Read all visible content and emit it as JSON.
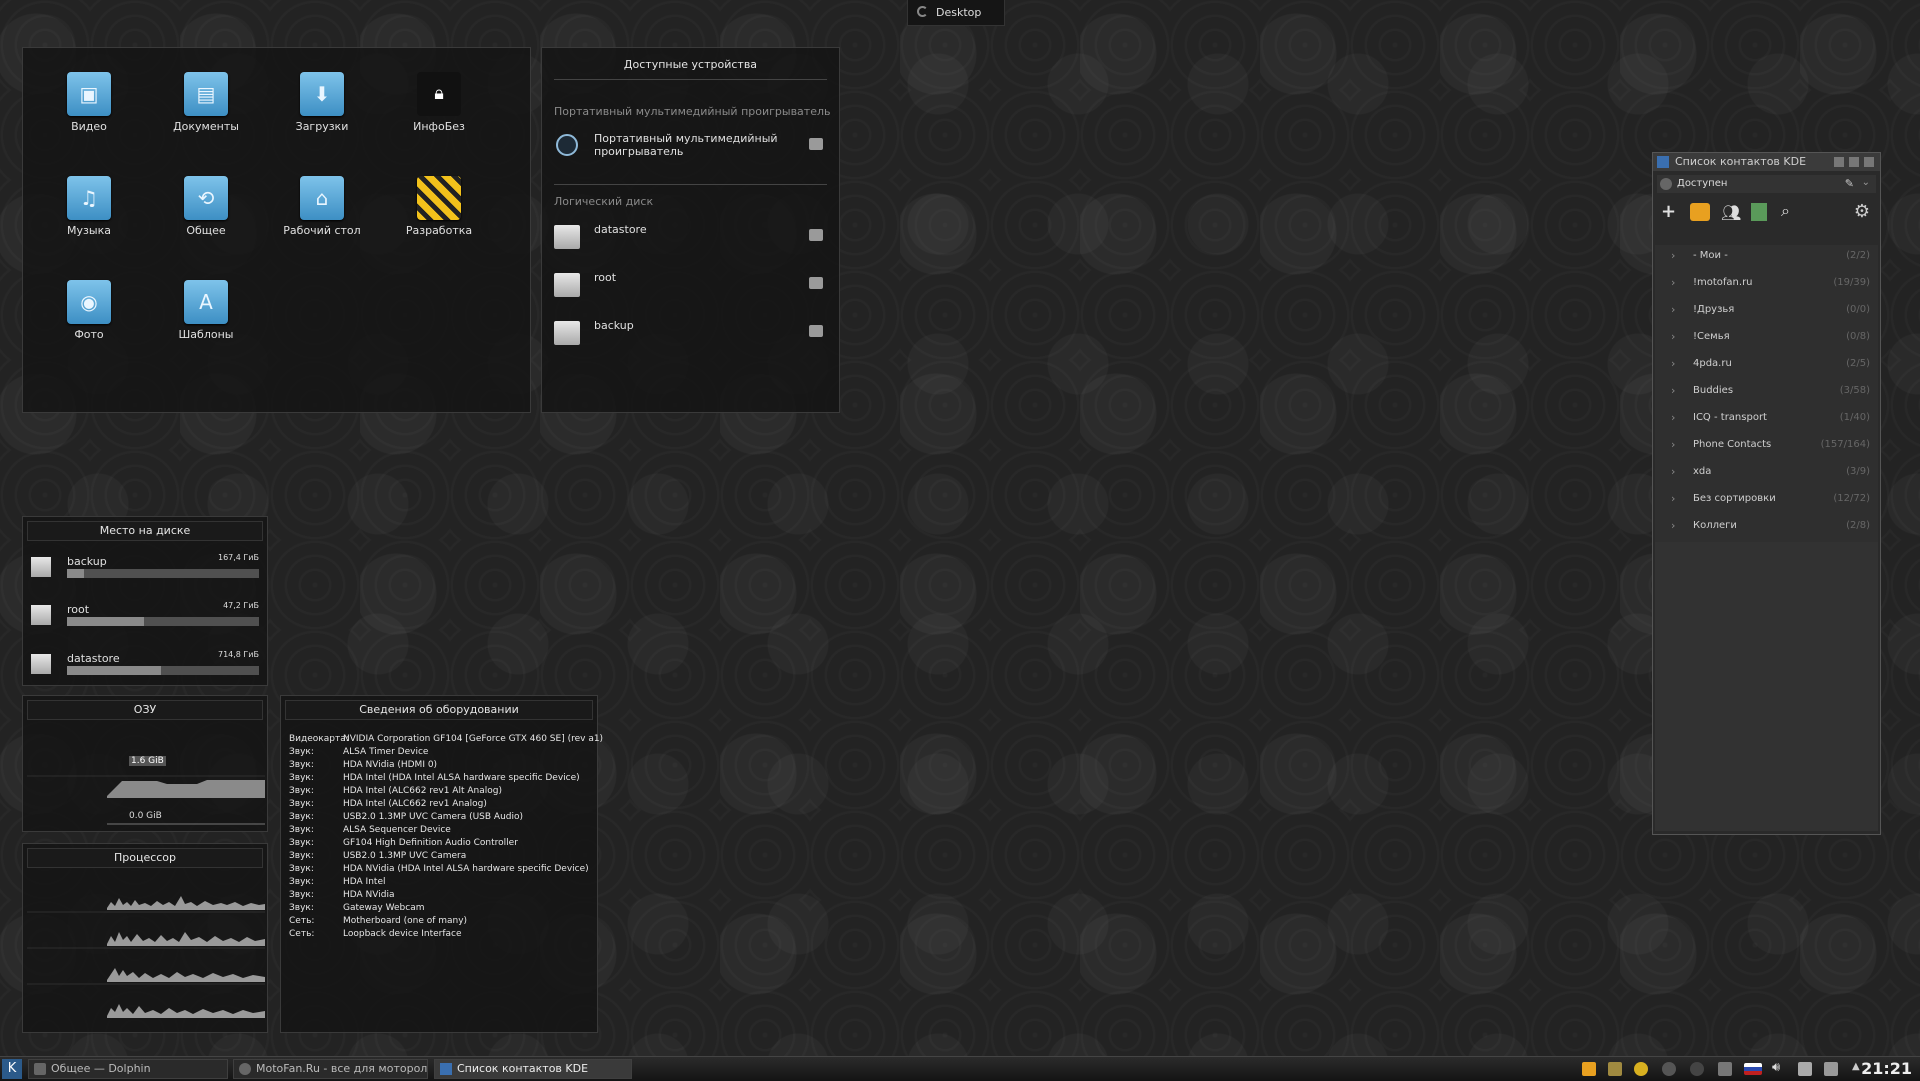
{
  "desktop_tab": {
    "label": "Desktop"
  },
  "folder_view": {
    "items": [
      {
        "label": "Видео",
        "icon": "video-folder-icon"
      },
      {
        "label": "Документы",
        "icon": "documents-folder-icon"
      },
      {
        "label": "Загрузки",
        "icon": "downloads-folder-icon"
      },
      {
        "label": "ИнфоБез",
        "icon": "lock-icon"
      },
      {
        "label": "Музыка",
        "icon": "music-folder-icon"
      },
      {
        "label": "Общее",
        "icon": "shared-folder-icon"
      },
      {
        "label": "Рабочий стол",
        "icon": "desktop-folder-icon"
      },
      {
        "label": "Разработка",
        "icon": "construction-icon"
      },
      {
        "label": "Фото",
        "icon": "photo-folder-icon"
      },
      {
        "label": "Шаблоны",
        "icon": "templates-folder-icon"
      }
    ]
  },
  "devices": {
    "title": "Доступные устройства",
    "section_player": "Портативный мультимедийный проигрыватель",
    "player_name": "Портативный мультимедийный проигрыватель",
    "section_disk": "Логический диск",
    "disks": [
      "datastore",
      "root",
      "backup"
    ]
  },
  "disk_space": {
    "title": "Место на диске",
    "items": [
      {
        "name": "backup",
        "size": "167,4 ГиБ",
        "used_fraction": 0.09
      },
      {
        "name": "root",
        "size": "47,2 ГиБ",
        "used_fraction": 0.4
      },
      {
        "name": "datastore",
        "size": "714,8 ГиБ",
        "used_fraction": 0.49
      }
    ]
  },
  "ram": {
    "title": "ОЗУ",
    "current": "1.6 GiB",
    "min": "0.0 GiB"
  },
  "cpu": {
    "title": "Процессор"
  },
  "hardware": {
    "title": "Сведения об оборудовании",
    "rows": [
      {
        "k": "Видеокарта:",
        "v": "NVIDIA Corporation GF104 [GeForce GTX 460 SE] (rev a1)"
      },
      {
        "k": "Звук:",
        "v": "ALSA Timer Device"
      },
      {
        "k": "Звук:",
        "v": "HDA NVidia (HDMI 0)"
      },
      {
        "k": "Звук:",
        "v": "HDA Intel (HDA Intel ALSA hardware specific Device)"
      },
      {
        "k": "Звук:",
        "v": "HDA Intel (ALC662 rev1 Alt Analog)"
      },
      {
        "k": "Звук:",
        "v": "HDA Intel (ALC662 rev1 Analog)"
      },
      {
        "k": "Звук:",
        "v": "USB2.0 1.3MP UVC Camera (USB Audio)"
      },
      {
        "k": "Звук:",
        "v": "ALSA Sequencer Device"
      },
      {
        "k": "Звук:",
        "v": "GF104 High Definition Audio Controller"
      },
      {
        "k": "Звук:",
        "v": "USB2.0 1.3MP UVC Camera"
      },
      {
        "k": "Звук:",
        "v": "HDA NVidia (HDA Intel ALSA hardware specific Device)"
      },
      {
        "k": "Звук:",
        "v": "HDA Intel"
      },
      {
        "k": "Звук:",
        "v": "HDA NVidia"
      },
      {
        "k": "Звук:",
        "v": "Gateway Webcam"
      },
      {
        "k": "Сеть:",
        "v": "Motherboard (one of many)"
      },
      {
        "k": "Сеть:",
        "v": "Loopback device Interface"
      }
    ]
  },
  "contacts": {
    "title": "Список контактов KDE",
    "status": "Доступен",
    "groups": [
      {
        "name": "- Мои -",
        "count": "(2/2)"
      },
      {
        "name": "!motofan.ru",
        "count": "(19/39)"
      },
      {
        "name": "!Друзья",
        "count": "(0/0)"
      },
      {
        "name": "!Семья",
        "count": "(0/8)"
      },
      {
        "name": "4pda.ru",
        "count": "(2/5)"
      },
      {
        "name": "Buddies",
        "count": "(3/58)"
      },
      {
        "name": "ICQ - transport",
        "count": "(1/40)"
      },
      {
        "name": "Phone Contacts",
        "count": "(157/164)"
      },
      {
        "name": "xda",
        "count": "(3/9)"
      },
      {
        "name": "Без сортировки",
        "count": "(12/72)"
      },
      {
        "name": "Коллеги",
        "count": "(2/8)"
      }
    ]
  },
  "taskbar": {
    "tasks": [
      {
        "label": "Общее — Dolphin"
      },
      {
        "label": "MotoFan.Ru - все для моторол..."
      },
      {
        "label": "Список контактов KDE"
      }
    ],
    "clock": "21:21"
  }
}
